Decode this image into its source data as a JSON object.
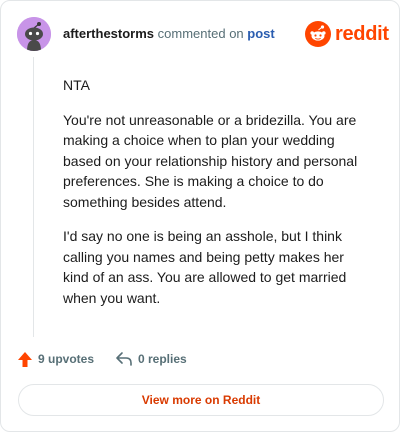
{
  "comment": {
    "author": "afterthestorms",
    "action_text": "commented on",
    "target_link": "post",
    "paragraphs": [
      "NTA",
      "You're not unreasonable or a bridezilla. You are making a choice when to plan your wedding based on your relationship history and personal preferences. She is making a choice to do something besides attend.",
      "I'd say no one is being an asshole, but I think calling you names and being petty makes her kind of an ass. You are allowed to get married when you want."
    ]
  },
  "brand": {
    "name": "reddit",
    "icon": "reddit-snoo-icon",
    "color": "#ff4500"
  },
  "stats": {
    "upvotes": "9 upvotes",
    "replies": "0 replies"
  },
  "cta": {
    "label": "View more on Reddit"
  },
  "icons": {
    "avatar": "snoo-avatar-icon",
    "upvote": "upvote-arrow-icon",
    "reply": "reply-arrow-icon"
  }
}
